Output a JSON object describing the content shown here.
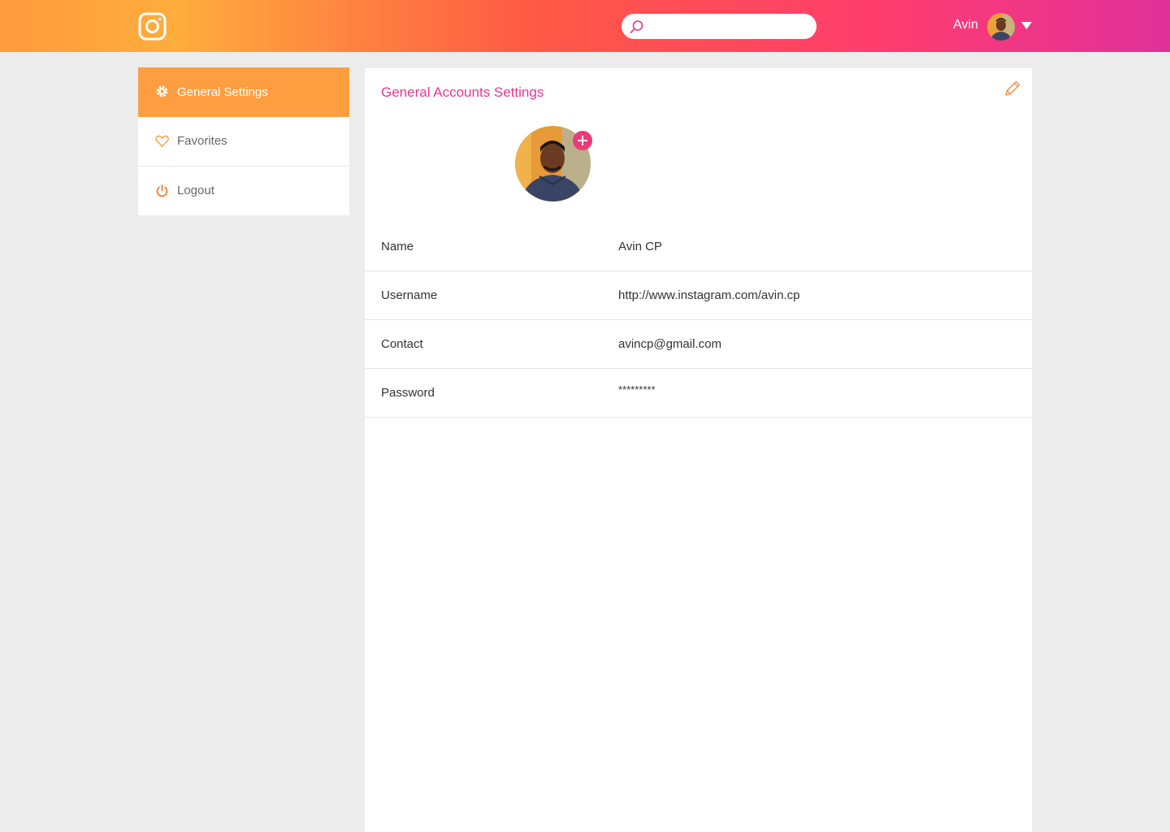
{
  "header": {
    "logo": "instagram-logo",
    "search": {
      "value": "",
      "placeholder": ""
    },
    "user": {
      "name": "Avin"
    }
  },
  "sidebar": {
    "items": [
      {
        "label": "General Settings",
        "icon": "gear-icon",
        "active": true
      },
      {
        "label": "Favorites",
        "icon": "heart-icon",
        "active": false
      },
      {
        "label": "Logout",
        "icon": "power-icon",
        "active": false
      }
    ]
  },
  "main": {
    "title": "General Accounts Settings",
    "fields": [
      {
        "label": "Name",
        "value": "Avin CP"
      },
      {
        "label": "Username",
        "value": "http://www.instagram.com/avin.cp"
      },
      {
        "label": "Contact",
        "value": "avincp@gmail.com"
      },
      {
        "label": "Password",
        "value": "*********"
      }
    ]
  },
  "colors": {
    "accent_orange": "#ff9e40",
    "accent_pink": "#e8368f",
    "add_button": "#ec3a78"
  }
}
